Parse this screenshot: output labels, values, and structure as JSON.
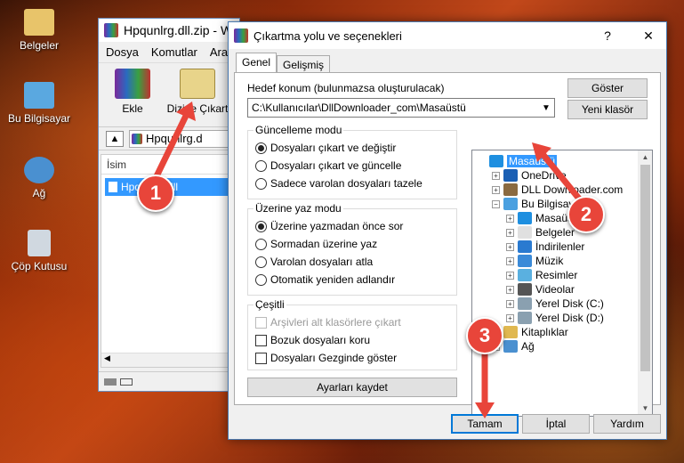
{
  "desktop": {
    "icons": [
      {
        "name": "desktop-icon-documents",
        "label": "Belgeler",
        "color": "#e8c46a"
      },
      {
        "name": "desktop-icon-this-pc",
        "label": "Bu Bilgisayar",
        "color": "#5aa8e0"
      },
      {
        "name": "desktop-icon-network",
        "label": "Ağ",
        "color": "#4a90d0"
      },
      {
        "name": "desktop-icon-recycle-bin",
        "label": "Çöp Kutusu",
        "color": "#d0d8e0"
      }
    ]
  },
  "winrar": {
    "title": "Hpqunlrg.dll.zip - Wi",
    "menu": [
      "Dosya",
      "Komutlar",
      "Araçla"
    ],
    "toolbar": {
      "add_label": "Ekle",
      "extract_label": "Dizine Çıkart"
    },
    "address": "Hpqunlrg.d",
    "column_name": "İsim",
    "file_name": "Hpqunlrg.dll"
  },
  "dialog": {
    "title": "Çıkartma yolu ve seçenekleri",
    "help_btn": "?",
    "close_btn": "✕",
    "tabs": [
      "Genel",
      "Gelişmiş"
    ],
    "dest_label": "Hedef konum (bulunmazsa oluşturulacak)",
    "dest_value": "C:\\Kullanıcılar\\DllDownloader_com\\Masaüstü",
    "show_btn": "Göster",
    "new_folder_btn": "Yeni klasör",
    "update_mode": {
      "title": "Güncelleme modu",
      "options": [
        "Dosyaları çıkart ve değiştir",
        "Dosyaları çıkart ve güncelle",
        "Sadece varolan dosyaları tazele"
      ],
      "selected": 0
    },
    "overwrite_mode": {
      "title": "Üzerine yaz modu",
      "options": [
        "Üzerine yazmadan önce sor",
        "Sormadan üzerine yaz",
        "Varolan dosyaları atla",
        "Otomatik yeniden adlandır"
      ],
      "selected": 0
    },
    "misc": {
      "title": "Çeşitli",
      "options": [
        "Arşivleri alt klasörlere çıkart",
        "Bozuk dosyaları koru",
        "Dosyaları Gezginde göster"
      ]
    },
    "save_settings_btn": "Ayarları kaydet",
    "tree": [
      {
        "label": "Masaüstü",
        "level": 0,
        "selected": true,
        "exp": "",
        "color": "#1e8fe0"
      },
      {
        "label": "OneDrive",
        "level": 1,
        "exp": "+",
        "color": "#1a5fb4"
      },
      {
        "label": "DLL Downloader.com",
        "level": 1,
        "exp": "+",
        "color": "#8a6a40"
      },
      {
        "label": "Bu Bilgisayar",
        "level": 1,
        "exp": "−",
        "color": "#4aa0e0"
      },
      {
        "label": "Masaüstü",
        "level": 2,
        "exp": "+",
        "color": "#1e8fe0"
      },
      {
        "label": "Belgeler",
        "level": 2,
        "exp": "+",
        "color": "#e0e0e0"
      },
      {
        "label": "İndirilenler",
        "level": 2,
        "exp": "+",
        "color": "#2a7ad0"
      },
      {
        "label": "Müzik",
        "level": 2,
        "exp": "+",
        "color": "#3a8ad8"
      },
      {
        "label": "Resimler",
        "level": 2,
        "exp": "+",
        "color": "#5ab0e0"
      },
      {
        "label": "Videolar",
        "level": 2,
        "exp": "+",
        "color": "#555555"
      },
      {
        "label": "Yerel Disk (C:)",
        "level": 2,
        "exp": "+",
        "color": "#8aa0b0"
      },
      {
        "label": "Yerel Disk (D:)",
        "level": 2,
        "exp": "+",
        "color": "#8aa0b0"
      },
      {
        "label": "Kitaplıklar",
        "level": 1,
        "exp": "+",
        "color": "#e0b850"
      },
      {
        "label": "Ağ",
        "level": 1,
        "exp": "+",
        "color": "#4a90d0"
      }
    ],
    "ok_btn": "Tamam",
    "cancel_btn": "İptal",
    "help_button": "Yardım"
  },
  "annotations": {
    "badge1": "1",
    "badge2": "2",
    "badge3": "3",
    "color": "#e8453a"
  }
}
